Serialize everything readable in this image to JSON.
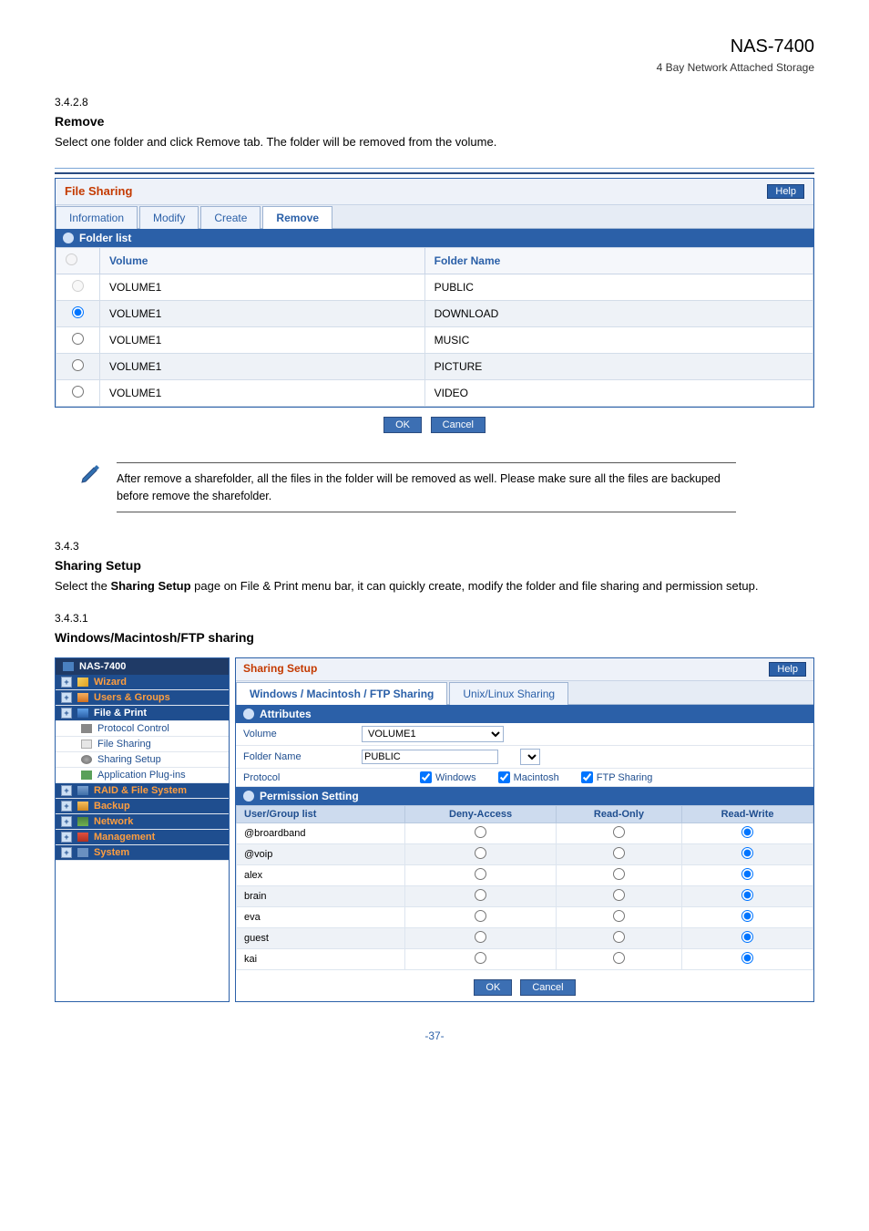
{
  "doc": {
    "title": "NAS-7400",
    "subtitle": "4 Bay Network Attached Storage",
    "footer": "-37-"
  },
  "sections": {
    "remove": {
      "num": "3.4.2.8",
      "label": "Remove",
      "body": "Select one folder and click Remove tab. The folder will be removed from the volume."
    },
    "sharing": {
      "num": "3.4.3",
      "label": "Sharing Setup",
      "body_prefix": "Select the ",
      "body_bold": "Sharing Setup",
      "body_suffix": " page on File & Print menu bar, it can quickly create, modify the folder and file sharing and permission setup."
    },
    "wmf": {
      "num": "3.4.3.1",
      "label": "Windows/Macintosh/FTP sharing"
    }
  },
  "file_sharing_panel": {
    "title": "File Sharing",
    "help": "Help",
    "tabs": [
      "Information",
      "Modify",
      "Create",
      "Remove"
    ],
    "subhead": "Folder list",
    "columns": {
      "sel": "",
      "volume": "Volume",
      "folder": "Folder Name"
    },
    "rows": [
      {
        "volume": "VOLUME1",
        "folder": "PUBLIC",
        "selected": false,
        "disabled": true
      },
      {
        "volume": "VOLUME1",
        "folder": "DOWNLOAD",
        "selected": true,
        "disabled": false
      },
      {
        "volume": "VOLUME1",
        "folder": "MUSIC",
        "selected": false,
        "disabled": false
      },
      {
        "volume": "VOLUME1",
        "folder": "PICTURE",
        "selected": false,
        "disabled": false
      },
      {
        "volume": "VOLUME1",
        "folder": "VIDEO",
        "selected": false,
        "disabled": false
      }
    ],
    "ok": "OK",
    "cancel": "Cancel"
  },
  "note": {
    "text": "After remove a sharefolder, all the files in the folder will be removed as well. Please make sure all the files are backuped before remove the sharefolder."
  },
  "nav": {
    "title": "NAS-7400",
    "items": [
      {
        "label": "Wizard",
        "type": "lvl1",
        "icon": "wand",
        "color": "orange"
      },
      {
        "label": "Users & Groups",
        "type": "lvl1",
        "icon": "users",
        "color": "orange"
      },
      {
        "label": "File & Print",
        "type": "lvl1",
        "icon": "printer",
        "color": "white"
      },
      {
        "label": "Protocol Control",
        "type": "sub",
        "icon": "disk1"
      },
      {
        "label": "File Sharing",
        "type": "sub",
        "icon": "disk2"
      },
      {
        "label": "Sharing Setup",
        "type": "sub",
        "icon": "gear2",
        "sel": true
      },
      {
        "label": "Application Plug-ins",
        "type": "sub",
        "icon": "plug"
      },
      {
        "label": "RAID & File System",
        "type": "lvl1",
        "icon": "raid",
        "color": "orange"
      },
      {
        "label": "Backup",
        "type": "lvl1",
        "icon": "backup",
        "color": "orange"
      },
      {
        "label": "Network",
        "type": "lvl1",
        "icon": "net",
        "color": "orange"
      },
      {
        "label": "Management",
        "type": "lvl1",
        "icon": "mgmt",
        "color": "orange"
      },
      {
        "label": "System",
        "type": "lvl1",
        "icon": "sys",
        "color": "orange"
      }
    ]
  },
  "sharing_setup_panel": {
    "title": "Sharing Setup",
    "help": "Help",
    "tabs": [
      "Windows / Macintosh / FTP Sharing",
      "Unix/Linux Sharing"
    ],
    "attributes_label": "Attributes",
    "volume_label": "Volume",
    "volume_value": "VOLUME1",
    "folder_label": "Folder Name",
    "folder_value": "PUBLIC",
    "protocol_label": "Protocol",
    "protocols": {
      "windows": "Windows",
      "macintosh": "Macintosh",
      "ftp": "FTP Sharing"
    },
    "perm_label": "Permission Setting",
    "perm_columns": {
      "user": "User/Group list",
      "deny": "Deny-Access",
      "ro": "Read-Only",
      "rw": "Read-Write"
    },
    "perm_rows": [
      {
        "user": "@broardband",
        "sel": "rw"
      },
      {
        "user": "@voip",
        "sel": "rw"
      },
      {
        "user": "alex",
        "sel": "rw"
      },
      {
        "user": "brain",
        "sel": "rw"
      },
      {
        "user": "eva",
        "sel": "rw"
      },
      {
        "user": "guest",
        "sel": "rw"
      },
      {
        "user": "kai",
        "sel": "rw"
      }
    ],
    "ok": "OK",
    "cancel": "Cancel"
  }
}
